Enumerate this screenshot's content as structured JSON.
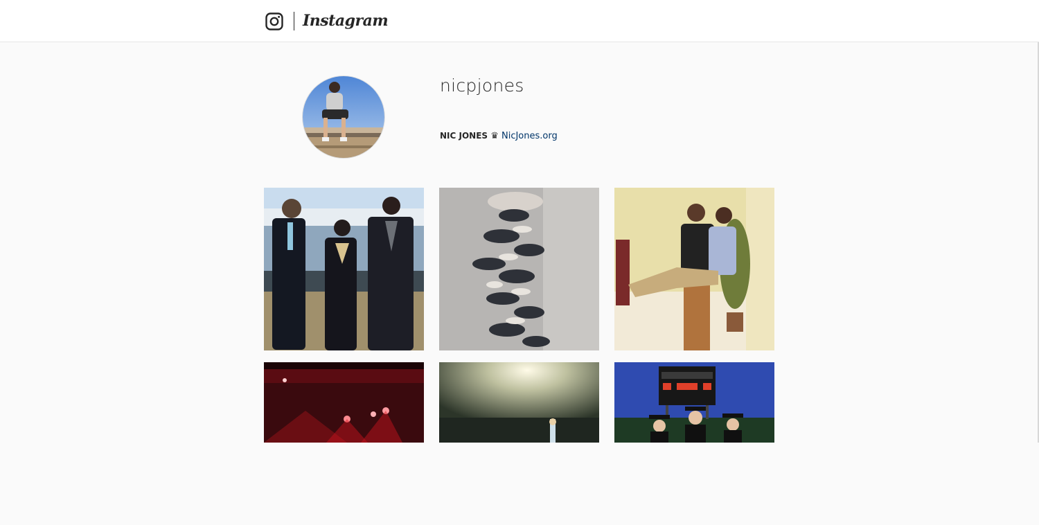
{
  "header": {
    "wordmark": "Instagram",
    "icons": {
      "logo": "camera-glyph-icon"
    }
  },
  "profile": {
    "username": "nicpjones",
    "full_name": "NIC JONES",
    "bio_separator": "♛",
    "website": "NicJones.org"
  },
  "posts": [
    {
      "subject": "three boys in tuxedos by the water"
    },
    {
      "subject": "pile of sneakers on floor"
    },
    {
      "subject": "two boys, one carrying the other"
    },
    {
      "subject": "concert stage red lights"
    },
    {
      "subject": "stage with spotlight and performer"
    },
    {
      "subject": "graduates under scoreboard"
    }
  ],
  "colors": {
    "topbar_bg": "#ffffff",
    "page_bg": "#fafafa",
    "text": "#262626",
    "link": "#003569"
  }
}
